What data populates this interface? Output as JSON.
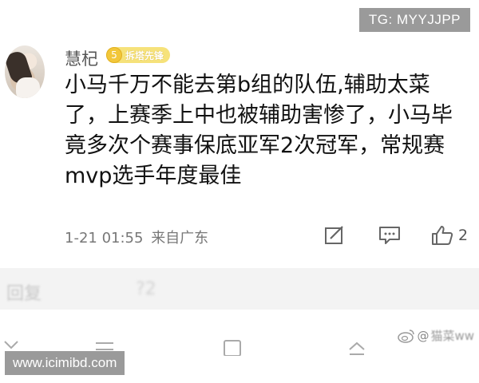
{
  "watermark_top": "TG: MYYJJPP",
  "comment": {
    "username": "慧杞",
    "badge": {
      "level": "5",
      "text": "拆塔先锋"
    },
    "text": "小马千万不能去第b组的队伍,辅助太菜了，上赛季上中也被辅助害惨了，小马毕竟多次个赛事保底亚军2次冠军，常规赛mvp选手年度最佳",
    "timestamp": "1-21 01:55",
    "source": "来自广东",
    "like_count": "2"
  },
  "reply_bar": {
    "label": "回复",
    "suffix": "?2"
  },
  "weibo_mark": {
    "at": "@",
    "name": "猫菜ww"
  },
  "watermark_bottom": "www.icimibd.com",
  "icons": [
    "edit-icon",
    "comment-icon",
    "like-icon",
    "nav-back-icon",
    "nav-home-icon",
    "nav-recent-icon",
    "nav-menu-icon",
    "weibo-logo-icon"
  ]
}
